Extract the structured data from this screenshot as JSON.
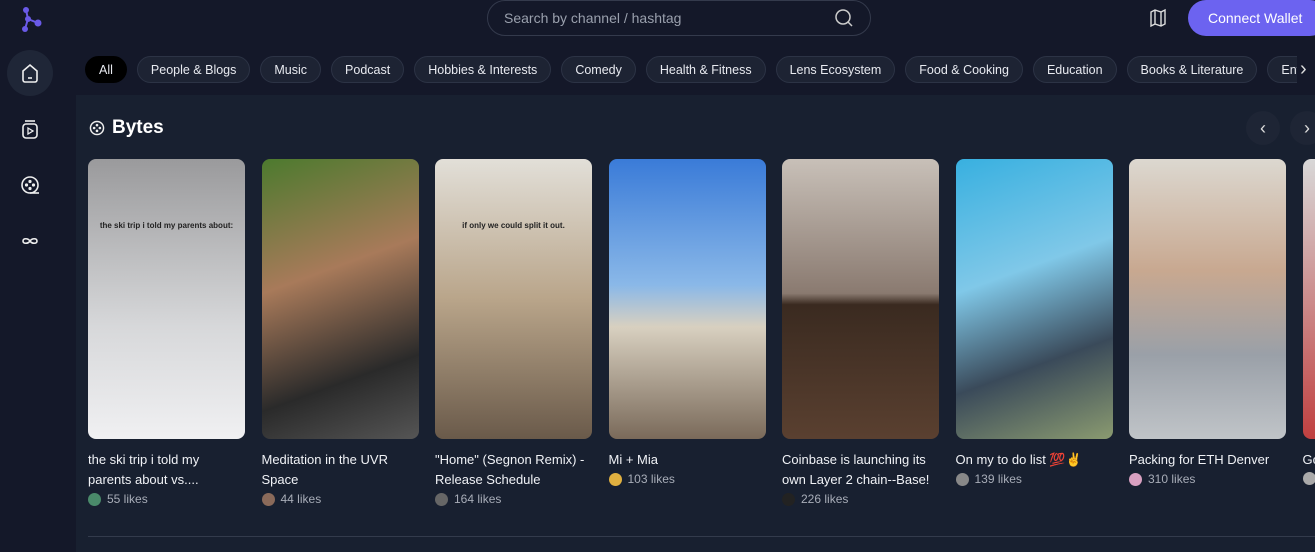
{
  "header": {
    "search_placeholder": "Search by channel / hashtag",
    "connect_wallet": "Connect Wallet",
    "brand_color": "#6c63f0"
  },
  "sidebar": {
    "items": [
      {
        "icon": "home-icon",
        "active": true
      },
      {
        "icon": "video-icon"
      },
      {
        "icon": "film-reel-icon"
      },
      {
        "icon": "infinity-icon"
      }
    ]
  },
  "categories": [
    "All",
    "People & Blogs",
    "Music",
    "Podcast",
    "Hobbies & Interests",
    "Comedy",
    "Health & Fitness",
    "Lens Ecosystem",
    "Food & Cooking",
    "Education",
    "Books & Literature",
    "Entertainment"
  ],
  "section": {
    "title": "Bytes"
  },
  "cards": [
    {
      "title": "the ski trip i told my parents about vs....",
      "likes": "55 likes",
      "caption": "the ski trip i told my parents about:",
      "bg": "linear-gradient(#9a9a9c,#d7d8da 60%,#f0f0f2)",
      "avatar": "#4a8a6a"
    },
    {
      "title": "Meditation in the UVR Space",
      "likes": "44 likes",
      "bg": "linear-gradient(160deg,#4c7a2e,#a87a5a 40%,#2a2a2a 75%,#555)",
      "avatar": "#8a6a5a"
    },
    {
      "title": "\"Home\" (Segnon Remix) - Release Schedule",
      "likes": "164 likes",
      "caption": "if only we could split it out.",
      "bg": "linear-gradient(#e2dfd8,#b9a58a 50%,#6a5a4a)",
      "avatar": "#666"
    },
    {
      "title": "Mi + Mia",
      "likes": "103 likes",
      "bg": "linear-gradient(#3a7bd8,#8ab8e8 45%,#d8d0c0 60%,#7a6a5a)",
      "avatar": "#e0b040"
    },
    {
      "title": "Coinbase is launching its own Layer 2 chain--Base!",
      "likes": "226 likes",
      "bg": "linear-gradient(#c8c0b8,#8a7a70 48%,#3a2a20 52%,#5a4030)",
      "avatar": "#222"
    },
    {
      "title": "On my to do list 💯✌",
      "likes": "139 likes",
      "bg": "linear-gradient(160deg,#38b0e0,#80c8e8 40%,#3a4a5a 70%,#8a9a70)",
      "avatar": "#888"
    },
    {
      "title": "Packing for ETH Denver",
      "likes": "310 likes",
      "bg": "linear-gradient(#dcd8d0,#c8a890 40%,#9aa0a8 70%,#c0c4c8)",
      "avatar": "#d8a0c0"
    },
    {
      "title": "Go",
      "likes": "",
      "bg": "linear-gradient(#d8d8d8,#c04040)",
      "avatar": "#aaa"
    }
  ]
}
